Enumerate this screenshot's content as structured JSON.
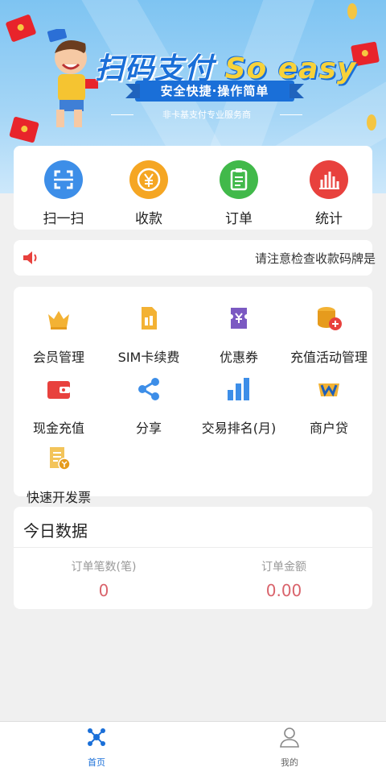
{
  "banner": {
    "title_cn": "扫码支付",
    "title_en": "So easy",
    "ribbon": "安全快捷·操作简单",
    "subtitle": "非卡基支付专业服务商"
  },
  "quick_actions": [
    {
      "label": "扫一扫",
      "icon": "scan-icon",
      "color": "#3d8ee8"
    },
    {
      "label": "收款",
      "icon": "yuan-coin-icon",
      "color": "#f5a623"
    },
    {
      "label": "订单",
      "icon": "clipboard-icon",
      "color": "#41b94a"
    },
    {
      "label": "统计",
      "icon": "bar-chart-icon",
      "color": "#e8413d"
    }
  ],
  "notice": {
    "icon": "speaker-icon",
    "text": "请注意检查收款码牌是"
  },
  "services": [
    {
      "label": "会员管理",
      "icon": "crown-icon"
    },
    {
      "label": "SIM卡续费",
      "icon": "sim-card-icon"
    },
    {
      "label": "优惠券",
      "icon": "coupon-icon"
    },
    {
      "label": "充值活动管理",
      "icon": "coins-plus-icon"
    },
    {
      "label": "现金充值",
      "icon": "wallet-icon"
    },
    {
      "label": "分享",
      "icon": "share-icon"
    },
    {
      "label": "交易排名(月)",
      "icon": "ranking-bars-icon"
    },
    {
      "label": "商户贷",
      "icon": "merchant-loan-icon"
    },
    {
      "label": "快速开发票",
      "icon": "invoice-icon"
    }
  ],
  "today": {
    "title": "今日数据",
    "stats": [
      {
        "label": "订单笔数(笔)",
        "value": "0"
      },
      {
        "label": "订单金额",
        "value": "0.00"
      }
    ]
  },
  "tabbar": [
    {
      "label": "首页",
      "icon": "home-network-icon",
      "active": true
    },
    {
      "label": "我的",
      "icon": "user-icon",
      "active": false
    }
  ],
  "colors": {
    "accent": "#1a6fd8",
    "stat_value": "#d9636b",
    "background": "#f0f0f0"
  }
}
